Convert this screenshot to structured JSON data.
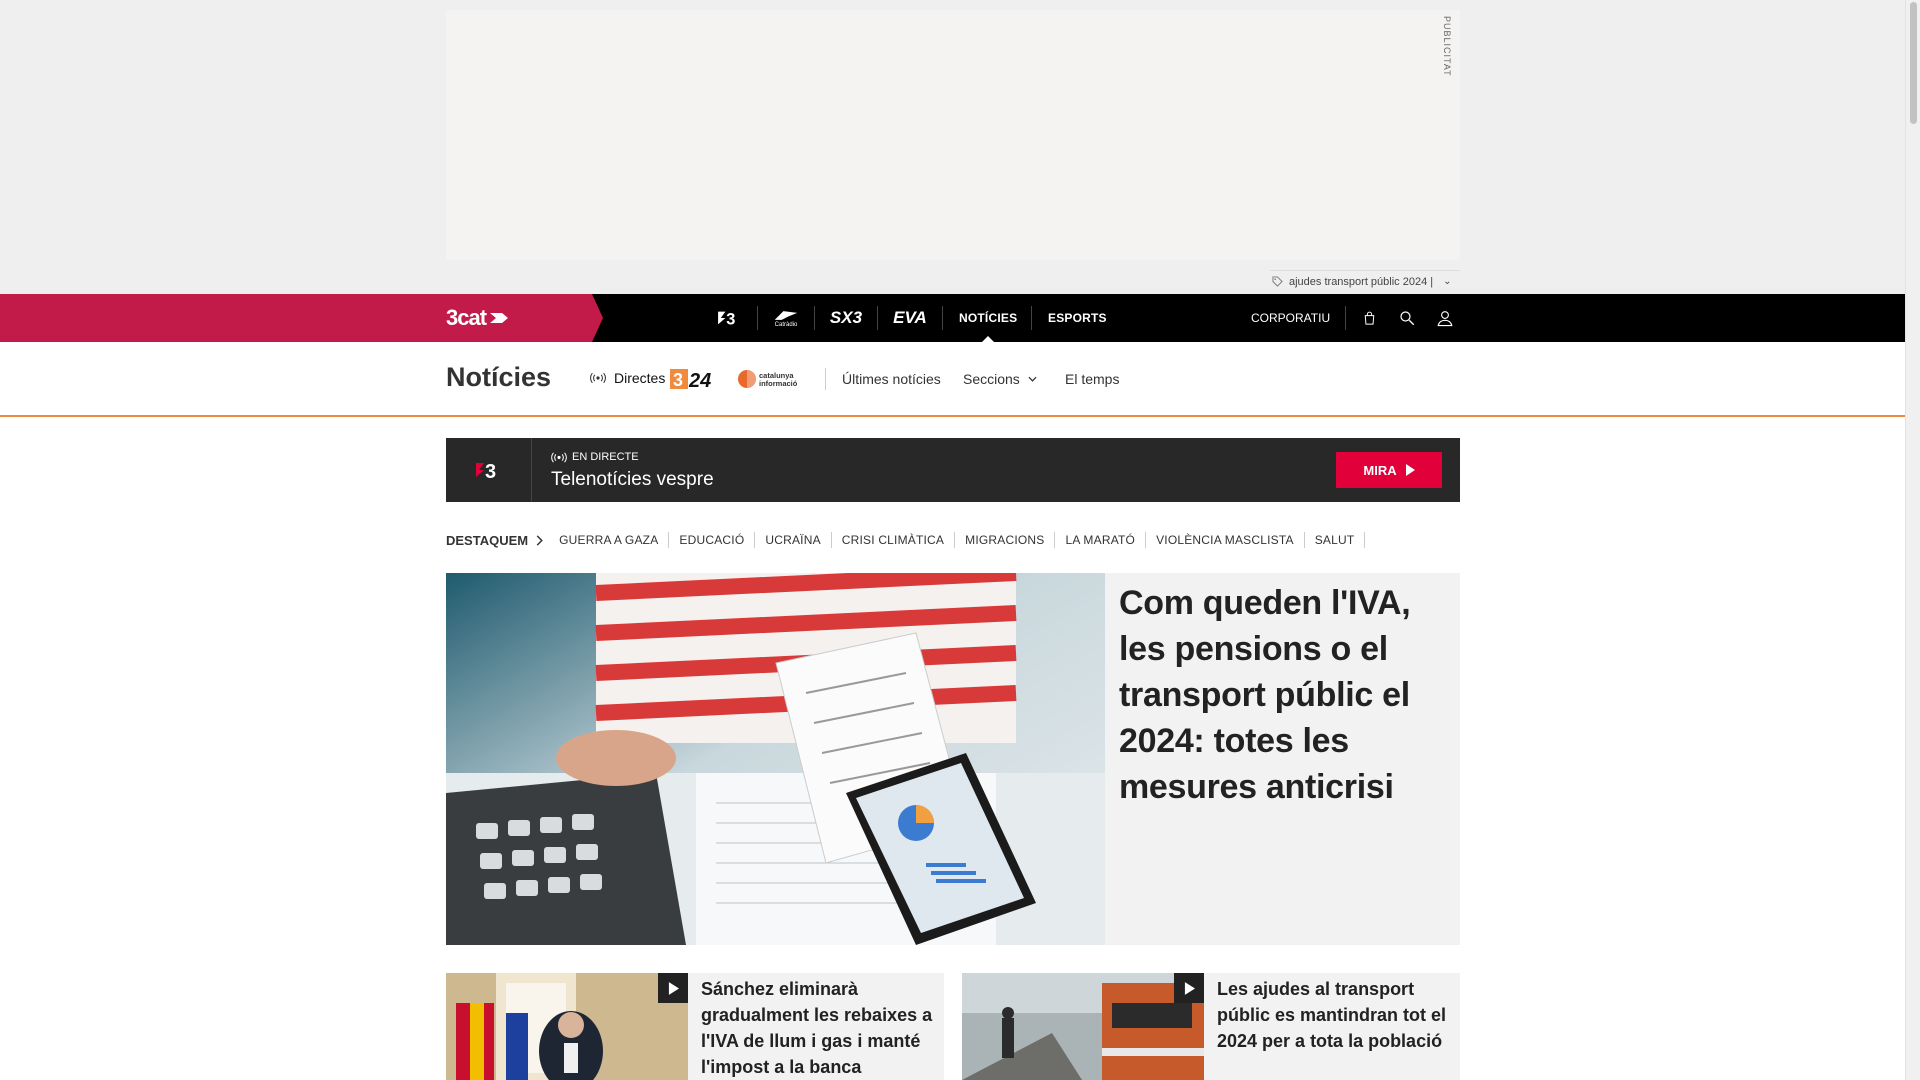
{
  "ad": {
    "label": "PUBLICITAT",
    "tagline": "ajudes transport públic 2024 |"
  },
  "topnav": {
    "brand": "3cat",
    "channels": [
      {
        "name": "tv3-logo-icon"
      },
      {
        "name": "catradio-logo-icon",
        "caption": "Catràdio"
      },
      {
        "name": "sx3-logo-icon",
        "text": "SX3"
      },
      {
        "name": "eva-logo-icon",
        "text": "EVA"
      }
    ],
    "links": {
      "noticies": "NOTÍCIES",
      "esports": "ESPORTS"
    },
    "corporatiu": "CORPORATIU",
    "colors": {
      "brand": "#c21b4a",
      "bar": "#000000"
    }
  },
  "section": {
    "title": "Notícies",
    "directes": "Directes",
    "logo_324": "3/24",
    "logo_ci": "catalunya informació",
    "links": {
      "ultimes": "Últimes notícies",
      "seccions": "Seccions",
      "temps": "El temps"
    },
    "accent": "#f08a3c"
  },
  "live": {
    "status": "EN DIRECTE",
    "title": "Telenotícies vespre",
    "button": "MIRA",
    "button_color": "#e2003a"
  },
  "destaquem": {
    "label": "DESTAQUEM",
    "items": [
      "GUERRA A GAZA",
      "EDUCACIÓ",
      "UCRAÏNA",
      "CRISI CLIMÀTICA",
      "MIGRACIONS",
      "LA MARATÓ",
      "VIOLÈNCIA MASCLISTA",
      "SALUT"
    ]
  },
  "hero": {
    "title": "Com queden l'IVA, les pensions o el transport públic el 2024: totes les mesures anticrisi"
  },
  "cards": [
    {
      "title": "Sánchez eliminarà gradualment les rebaixes a l'IVA de llum i gas i manté l'impost a la banca"
    },
    {
      "title": "Les ajudes al transport públic es mantindran tot el 2024 per a tota la població"
    }
  ]
}
